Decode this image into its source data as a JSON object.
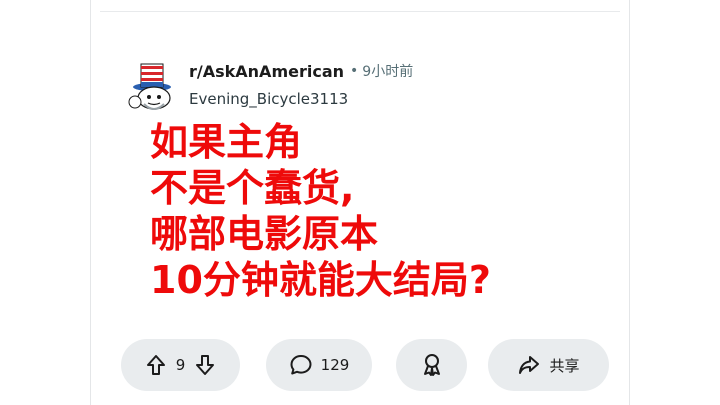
{
  "post": {
    "subreddit": "r/AskAnAmerican",
    "separator": "•",
    "time_ago": "9小时前",
    "author": "Evening_Bicycle3113",
    "title_lines": [
      "如果主角",
      "不是个蠢货,",
      "哪部电影原本",
      "10分钟就能大结局?"
    ]
  },
  "actions": {
    "vote_count": "9",
    "comment_count": "129",
    "share_label": "共享"
  },
  "colors": {
    "title": "#ee0a0a",
    "pill_background": "#e9ecee",
    "meta_text": "#576f76"
  },
  "icons": {
    "avatar": "uncle-sam-snoo-avatar",
    "upvote": "arrow-up-icon",
    "downvote": "arrow-down-icon",
    "comment": "speech-bubble-icon",
    "award": "award-icon",
    "share": "share-arrow-icon"
  }
}
